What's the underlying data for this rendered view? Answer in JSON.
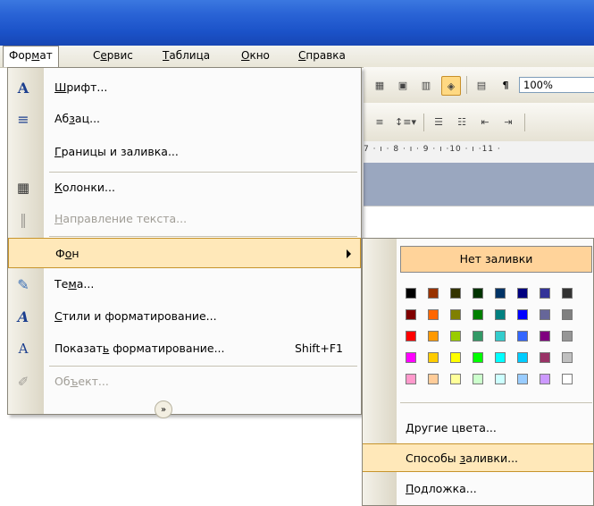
{
  "menubar": {
    "items": [
      {
        "pre": "Фор",
        "u": "м",
        "post": "ат"
      },
      {
        "pre": "С",
        "u": "е",
        "post": "рвис"
      },
      {
        "pre": "",
        "u": "Т",
        "post": "аблица"
      },
      {
        "pre": "",
        "u": "О",
        "post": "кно"
      },
      {
        "pre": "",
        "u": "С",
        "post": "правка"
      }
    ]
  },
  "toolbar": {
    "zoom": "100%",
    "pilcrow": "¶"
  },
  "ruler": {
    "text": "7 · ı · 8 · ı · 9 · ı ·10 · ı ·11 ·"
  },
  "format_menu": {
    "items": [
      {
        "icon": "A",
        "icon_name": "font-icon",
        "pre": "",
        "u": "Ш",
        "post": "рифт...",
        "shortcut": "",
        "disabled": false
      },
      {
        "icon": "≡",
        "icon_name": "paragraph-icon",
        "pre": "Аб",
        "u": "з",
        "post": "ац...",
        "shortcut": "",
        "disabled": false
      },
      {
        "icon": "",
        "icon_name": "",
        "pre": "",
        "u": "Г",
        "post": "раницы и заливка...",
        "shortcut": "",
        "disabled": false
      },
      {
        "icon": "▦",
        "icon_name": "columns-icon",
        "pre": "",
        "u": "К",
        "post": "олонки...",
        "shortcut": "",
        "disabled": false
      },
      {
        "icon": "‖",
        "icon_name": "text-direction-icon",
        "pre": "",
        "u": "Н",
        "post": "аправление текста...",
        "shortcut": "",
        "disabled": true
      },
      {
        "icon": "",
        "icon_name": "",
        "pre": "Ф",
        "u": "о",
        "post": "н",
        "shortcut": "",
        "disabled": false
      },
      {
        "icon": "✎",
        "icon_name": "theme-icon",
        "pre": "Те",
        "u": "м",
        "post": "а...",
        "shortcut": "",
        "disabled": false
      },
      {
        "icon": "A",
        "icon_name": "styles-icon",
        "pre": "",
        "u": "С",
        "post": "тили и форматирование...",
        "shortcut": "",
        "disabled": false
      },
      {
        "icon": "A",
        "icon_name": "reveal-formatting-icon",
        "pre": "Показат",
        "u": "ь",
        "post": " форматирование...",
        "shortcut": "Shift+F1",
        "disabled": false
      },
      {
        "icon": "✐",
        "icon_name": "object-icon",
        "pre": "Об",
        "u": "ъ",
        "post": "ект...",
        "shortcut": "",
        "disabled": true
      }
    ]
  },
  "background_submenu": {
    "no_fill": "Нет заливки",
    "swatches": [
      [
        "#000000",
        "#993300",
        "#333300",
        "#003300",
        "#003366",
        "#000080",
        "#333399",
        "#333333"
      ],
      [
        "#800000",
        "#ff6600",
        "#808000",
        "#008000",
        "#008080",
        "#0000ff",
        "#666699",
        "#808080"
      ],
      [
        "#ff0000",
        "#ff9900",
        "#99cc00",
        "#339966",
        "#33cccc",
        "#3366ff",
        "#800080",
        "#969696"
      ],
      [
        "#ff00ff",
        "#ffcc00",
        "#ffff00",
        "#00ff00",
        "#00ffff",
        "#00ccff",
        "#993366",
        "#c0c0c0"
      ],
      [
        "#ff99cc",
        "#ffcc99",
        "#ffff99",
        "#ccffcc",
        "#ccffff",
        "#99ccff",
        "#cc99ff",
        "#ffffff"
      ]
    ],
    "items": [
      {
        "pre": "",
        "u": "Д",
        "post": "ругие цвета..."
      },
      {
        "pre": "Способы ",
        "u": "з",
        "post": "аливки..."
      },
      {
        "pre": "",
        "u": "П",
        "post": "одложка..."
      }
    ]
  },
  "colors": {
    "highlight": "#ffe8b9",
    "no_fill_bg": "#ffd39a",
    "title_blue": "#2a64d6"
  }
}
